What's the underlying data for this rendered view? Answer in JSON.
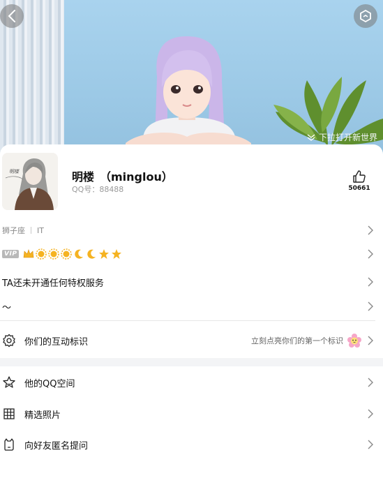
{
  "hero": {
    "pull_hint": "下拉打开新世界",
    "back_icon": "back-arrow-icon",
    "hex_icon": "hexagon-settings-icon"
  },
  "profile": {
    "nickname": "明楼　（minglou）",
    "qq_label": "QQ号：88488",
    "like_count": "50661",
    "avatar_caption": "明楼"
  },
  "tags": {
    "zodiac": "狮子座",
    "job": "IT"
  },
  "vip": {
    "badge": "VIP",
    "levels": [
      "crown",
      "sun",
      "sun",
      "sun",
      "moon",
      "moon",
      "star",
      "star"
    ]
  },
  "privilege_text": "TA还未开通任何特权服务",
  "signature": "～",
  "interaction": {
    "label": "你们的互动标识",
    "hint": "立刻点亮你们的第一个标识"
  },
  "menu": [
    {
      "label": "他的QQ空间",
      "icon": "star-outline-icon"
    },
    {
      "label": "精选照片",
      "icon": "grid-icon"
    },
    {
      "label": "向好友匿名提问",
      "icon": "anonymous-question-icon"
    }
  ],
  "colors": {
    "accent_gold": "#f5b322",
    "hero_bg": "#a9d3ee"
  }
}
